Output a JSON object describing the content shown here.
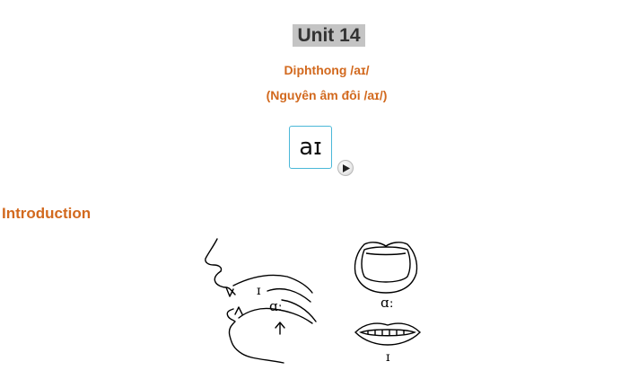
{
  "lesson": {
    "unit_title": "Unit 14",
    "subtitle_en": "Diphthong /aɪ/",
    "subtitle_vi": "(Nguyên âm đôi /aɪ/)"
  },
  "phoneme": {
    "symbol": "aɪ",
    "play_icon": "play-icon"
  },
  "section": {
    "heading": "Introduction"
  },
  "illustration": {
    "mouth_labels": {
      "upper": "ɪ",
      "lower": "ɑː"
    },
    "lips_labels": {
      "open": "ɑː",
      "spread": "ɪ"
    }
  },
  "colors": {
    "accent": "#d2691e",
    "title_bg": "#c4c4c4",
    "card_border": "#4bb8d8"
  }
}
